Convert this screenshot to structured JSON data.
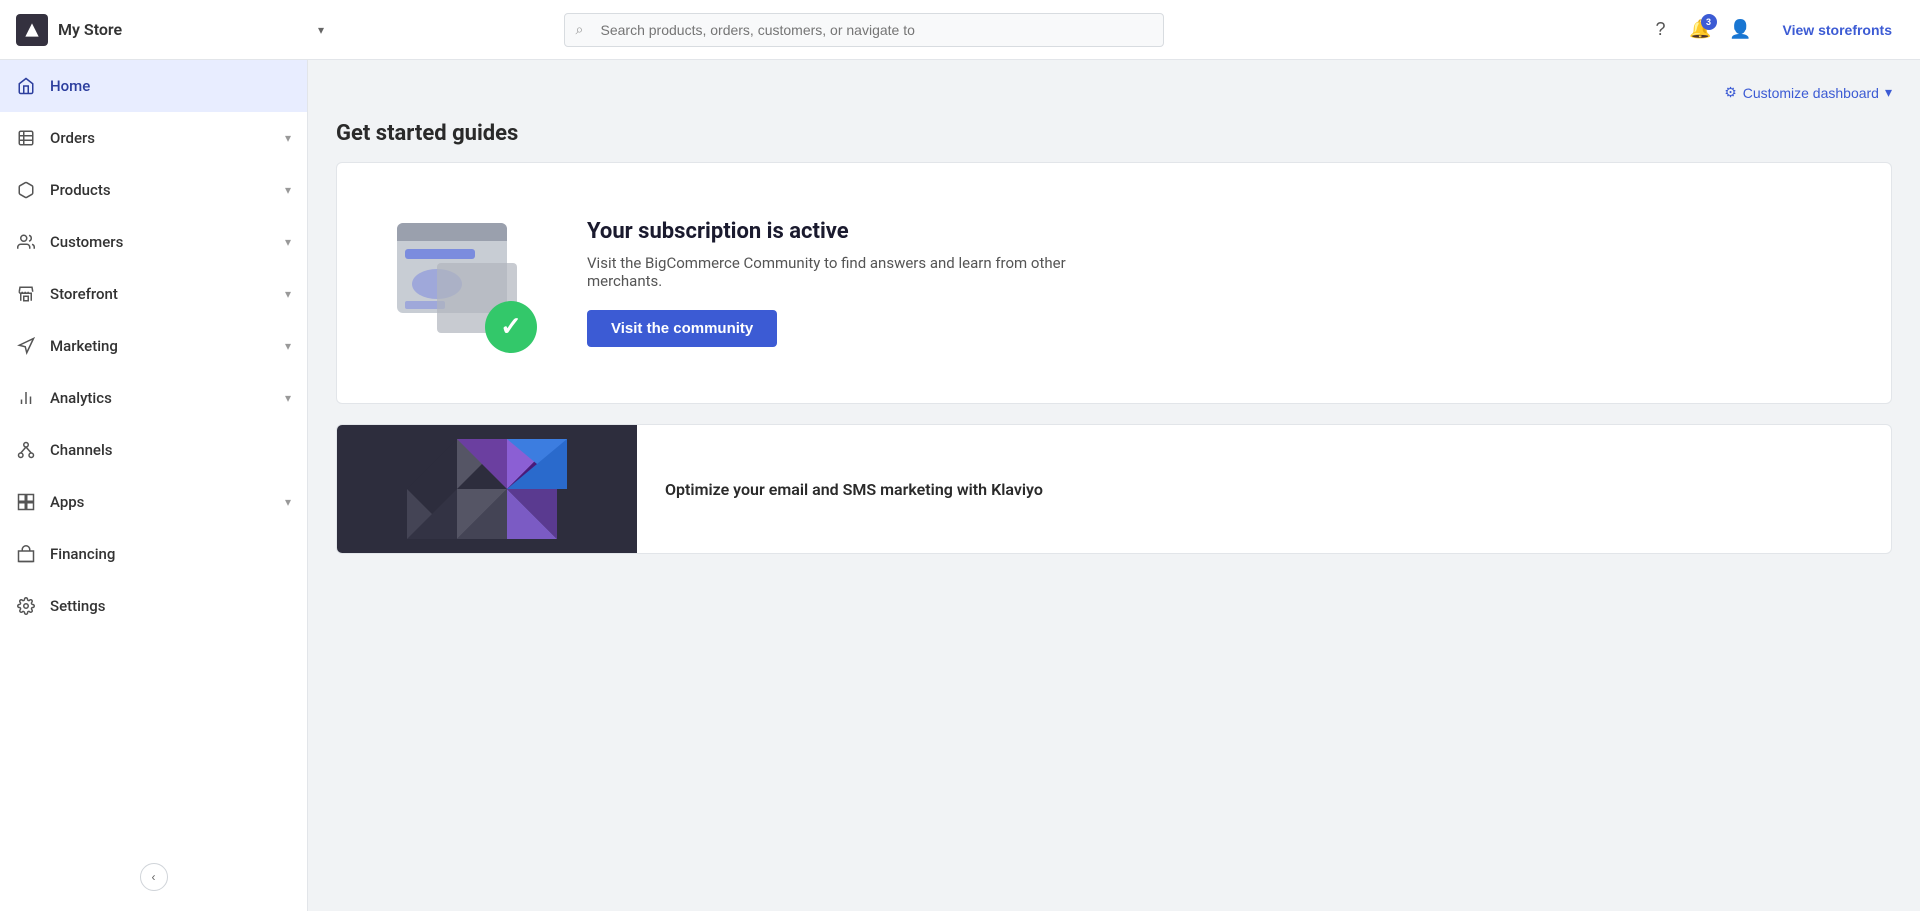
{
  "header": {
    "store_name": "My Store",
    "search_placeholder": "Search products, orders, customers, or navigate to",
    "notifications_count": "3",
    "view_storefronts_label": "View storefronts"
  },
  "sidebar": {
    "items": [
      {
        "id": "home",
        "label": "Home",
        "icon": "home-icon",
        "active": true,
        "has_arrow": false
      },
      {
        "id": "orders",
        "label": "Orders",
        "icon": "orders-icon",
        "active": false,
        "has_arrow": true
      },
      {
        "id": "products",
        "label": "Products",
        "icon": "products-icon",
        "active": false,
        "has_arrow": true
      },
      {
        "id": "customers",
        "label": "Customers",
        "icon": "customers-icon",
        "active": false,
        "has_arrow": true
      },
      {
        "id": "storefront",
        "label": "Storefront",
        "icon": "storefront-icon",
        "active": false,
        "has_arrow": true
      },
      {
        "id": "marketing",
        "label": "Marketing",
        "icon": "marketing-icon",
        "active": false,
        "has_arrow": true
      },
      {
        "id": "analytics",
        "label": "Analytics",
        "icon": "analytics-icon",
        "active": false,
        "has_arrow": true
      },
      {
        "id": "channels",
        "label": "Channels",
        "icon": "channels-icon",
        "active": false,
        "has_arrow": false
      },
      {
        "id": "apps",
        "label": "Apps",
        "icon": "apps-icon",
        "active": false,
        "has_arrow": true
      },
      {
        "id": "financing",
        "label": "Financing",
        "icon": "financing-icon",
        "active": false,
        "has_arrow": false
      },
      {
        "id": "settings",
        "label": "Settings",
        "icon": "settings-icon",
        "active": false,
        "has_arrow": false
      }
    ]
  },
  "main": {
    "customize_label": "Customize dashboard",
    "page_title": "Get started guides",
    "guide_card": {
      "title": "Your subscription is active",
      "description": "Visit the BigCommerce Community to find answers and learn from other merchants.",
      "button_label": "Visit the community"
    },
    "promo_card": {
      "text": "Optimize your email and SMS marketing with Klaviyo"
    }
  }
}
